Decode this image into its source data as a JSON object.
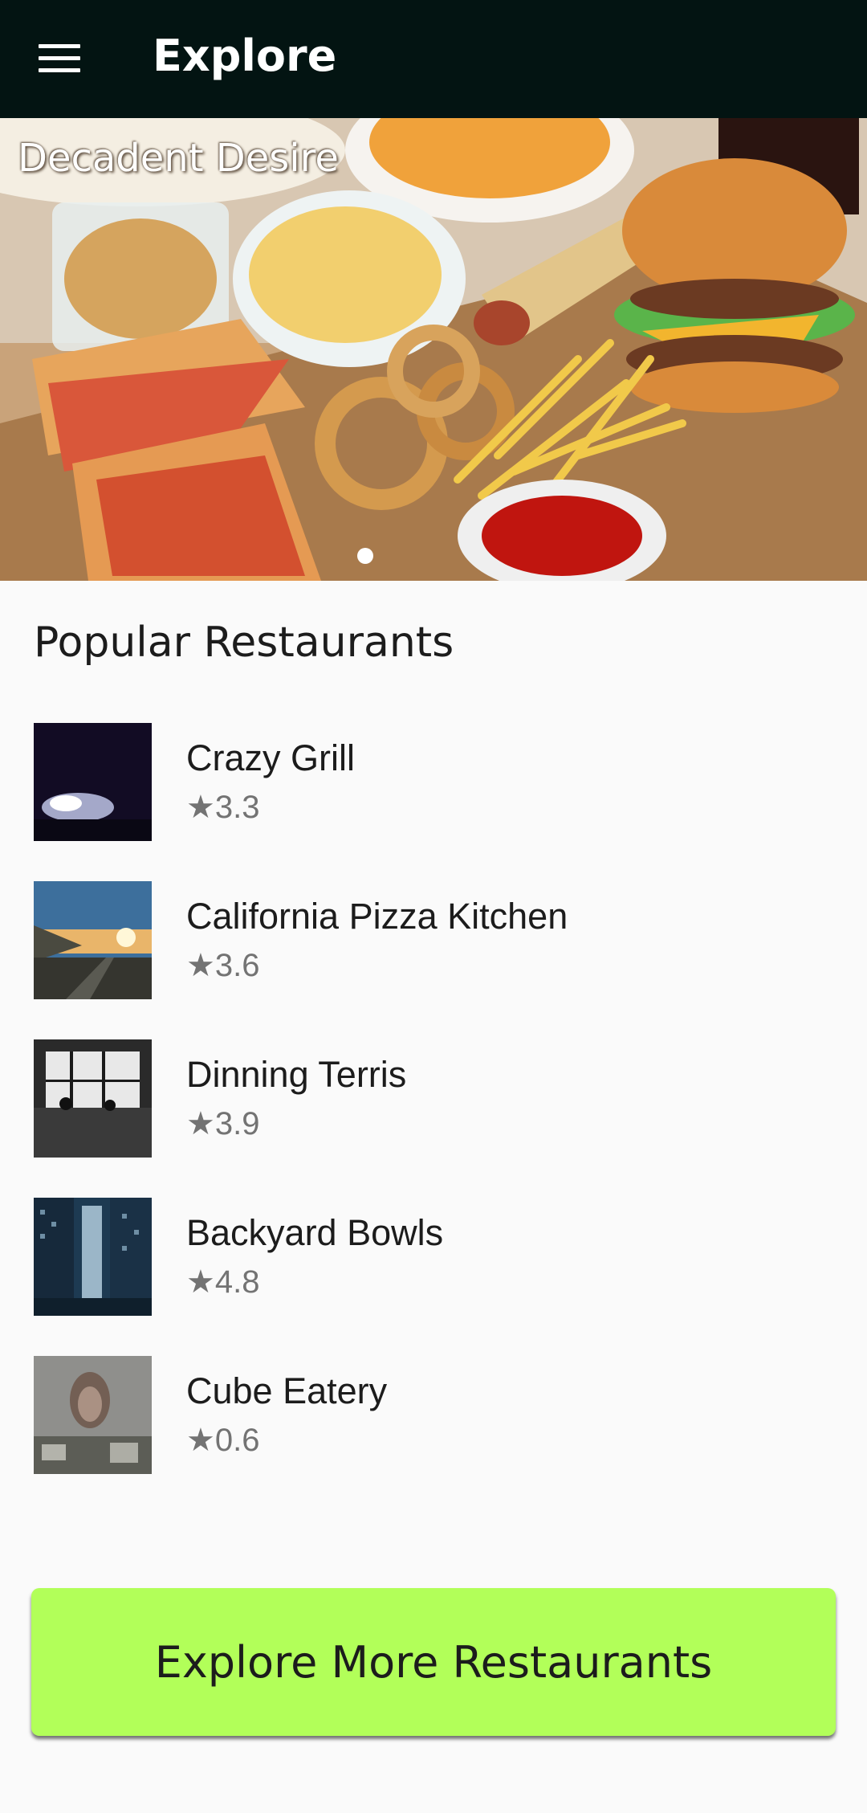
{
  "appbar": {
    "title": "Explore",
    "menu_icon": "menu-icon"
  },
  "hero": {
    "caption": "Decadent Desire",
    "image_subject": "fast food spread: pizza, chips, onion rings, fries, burger, hot dog, ketchup"
  },
  "popular": {
    "title": "Popular Restaurants",
    "items": [
      {
        "name": "Crazy Grill",
        "rating": "★3.3",
        "rating_value": 3.3
      },
      {
        "name": "California Pizza Kitchen",
        "rating": "★3.6",
        "rating_value": 3.6
      },
      {
        "name": "Dinning Terris",
        "rating": "★3.9",
        "rating_value": 3.9
      },
      {
        "name": "Backyard Bowls",
        "rating": "★4.8",
        "rating_value": 4.8
      },
      {
        "name": "Cube Eatery",
        "rating": "★0.6",
        "rating_value": 0.6
      }
    ]
  },
  "explore_button": {
    "label": "Explore More Restaurants"
  },
  "colors": {
    "appbar": "#031412",
    "button": "#b2ff59",
    "background": "#fafafa",
    "rating_text": "#737373"
  }
}
